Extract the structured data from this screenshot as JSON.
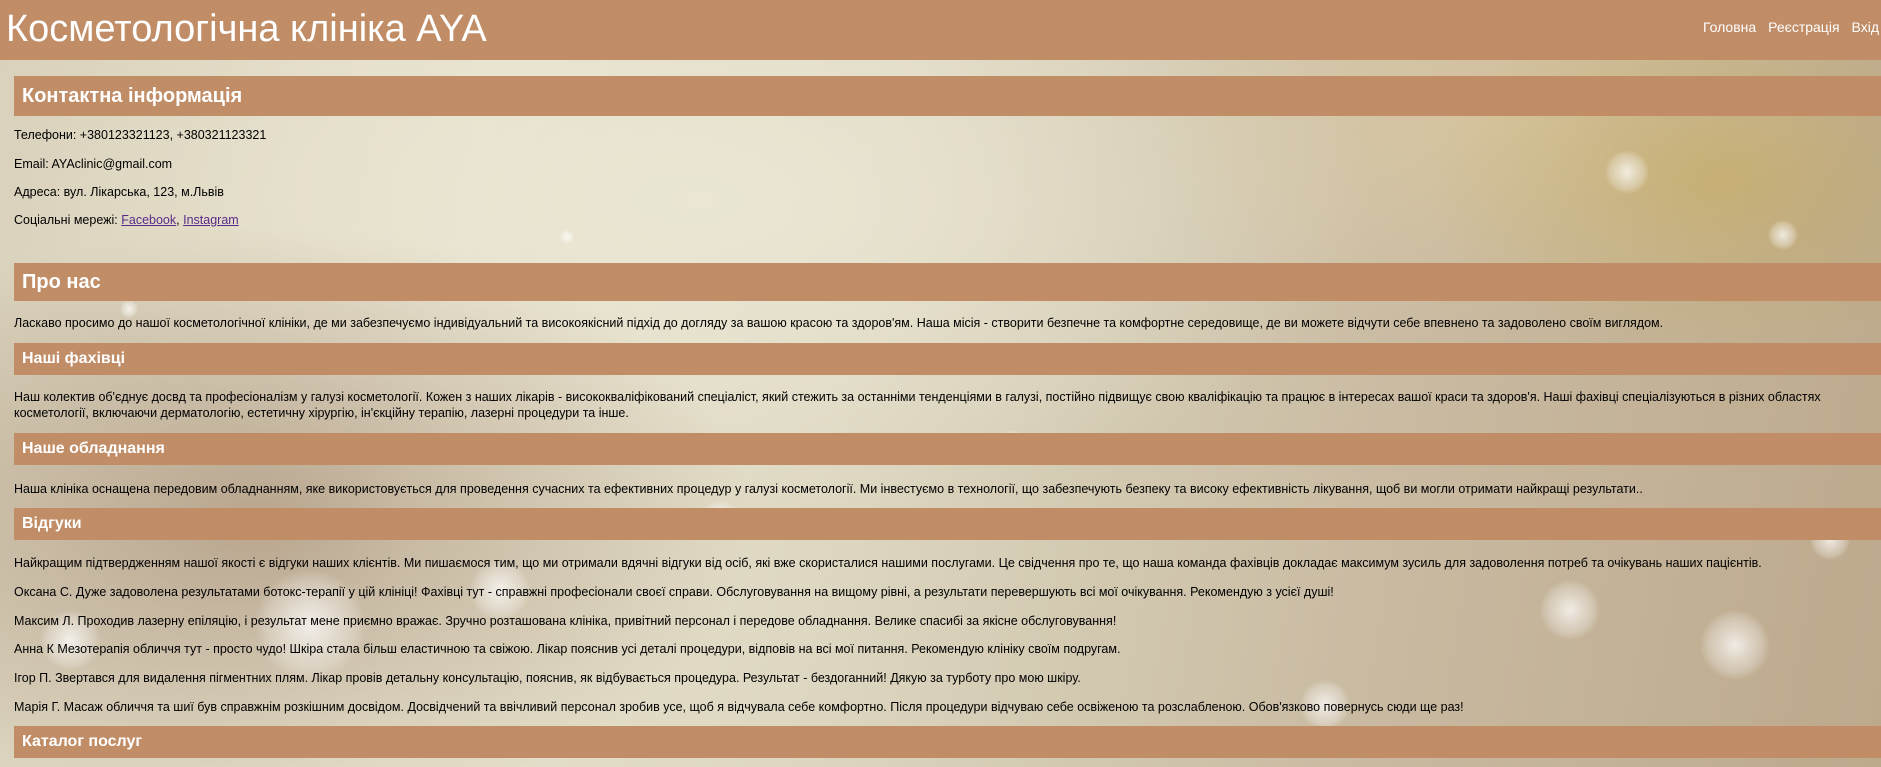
{
  "header": {
    "site_title": "Косметологічна клініка AYA",
    "nav": [
      "Головна",
      "Реєстрація",
      "Вхід"
    ]
  },
  "contacts": {
    "heading": "Контактна інформація",
    "phones": "Телефони: +380123321123, +380321123321",
    "email": "Email: AYAclinic@gmail.com",
    "address": "Адреса: вул. Лікарська, 123, м.Львів",
    "social_label": "Соціальні мережі:",
    "social_sep": ",",
    "facebook": "Facebook",
    "instagram": "Instagram"
  },
  "about": {
    "heading": "Про нас",
    "text": "Ласкаво просимо до нашої косметологічної клініки, де ми забезпечуємо індивідуальний та високоякісний підхід до догляду за вашою красою та здоров'ям. Наша місія - створити безпечне та комфортне середовище, де ви можете відчути себе впевнено та задоволено своїм виглядом."
  },
  "specialists": {
    "heading": "Наші фахівці",
    "text": "Наш колектив об'єднує досвд та професіоналізм у галузі косметології. Кожен з наших лікарів - висококваліфікований спеціаліст, який стежить за останніми тенденціями в галузі, постійно підвищує свою кваліфікацію та працює в інтересах вашої краси та здоров'я. Наші фахівці спеціалізуються в різних областях косметології, включаючи дерматологію, естетичну хірургію, ін'єкційну терапію, лазерні процедури та інше."
  },
  "equipment": {
    "heading": "Наше обладнання",
    "text": "Наша клініка оснащена передовим обладнанням, яке використовується для проведення сучасних та ефективних процедур у галузі косметології. Ми інвестуємо в технології, що забезпечують безпеку та високу ефективність лікування, щоб ви могли отримати найкращі результати.."
  },
  "reviews": {
    "heading": "Відгуки",
    "intro": "Найкращим підтвердженням нашої якості є відгуки наших клієнтів. Ми пишаємося тим, що ми отримали вдячні відгуки від осіб, які вже скористалися нашими послугами. Це свідчення про те, що наша команда фахівців докладає максимум зусиль для задоволення потреб та очікувань наших пацієнтів.",
    "items": [
      "Оксана С. Дуже задоволена результатами ботокс-терапії у цій клініці! Фахівці тут - справжні професіонали своєї справи. Обслуговування на вищому рівні, а результати перевершують всі мої очікування. Рекомендую з усієї душі!",
      "Максим Л. Проходив лазерну епіляцію, і результат мене приємно вражає. Зручно розташована клініка, привітний персонал і передове обладнання. Велике спасибі за якісне обслуговування!",
      "Анна К Мезотерапія обличчя тут - просто чудо! Шкіра стала більш еластичною та свіжою. Лікар пояснив усі деталі процедури, відповів на всі мої питання. Рекомендую клініку своїм подругам.",
      "Ігор П. Звертався для видалення пігментних плям. Лікар провів детальну консультацію, пояснив, як відбувається процедура. Результат - бездоганний! Дякую за турботу про мою шкіру.",
      "Марія Г. Масаж обличчя та шиї був справжнім розкішним досвідом. Досвідчений та ввічливий персонал зробив усе, щоб я відчувала себе комфортно. Після процедури відчуваю себе освіженою та розслабленою. Обов'язково повернусь сюди ще раз!"
    ]
  },
  "catalog": {
    "heading": "Каталог послуг"
  }
}
